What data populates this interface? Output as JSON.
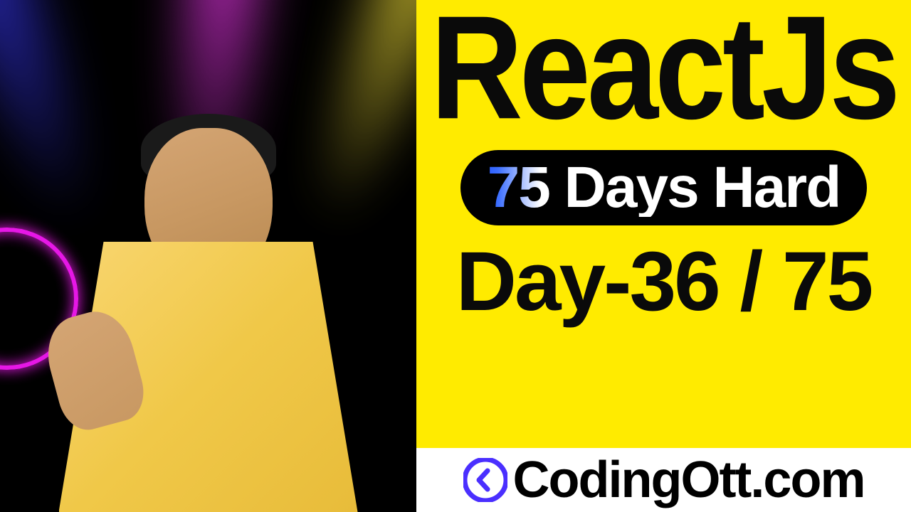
{
  "thumbnail": {
    "title": "ReactJs",
    "badge": "75 Days Hard",
    "day_counter": "Day-36 / 75",
    "brand": "CodingOtt.com"
  },
  "colors": {
    "accent_bg": "#ffeb00",
    "pill_bg": "#000000",
    "brand_accent": "#4a2fff"
  }
}
